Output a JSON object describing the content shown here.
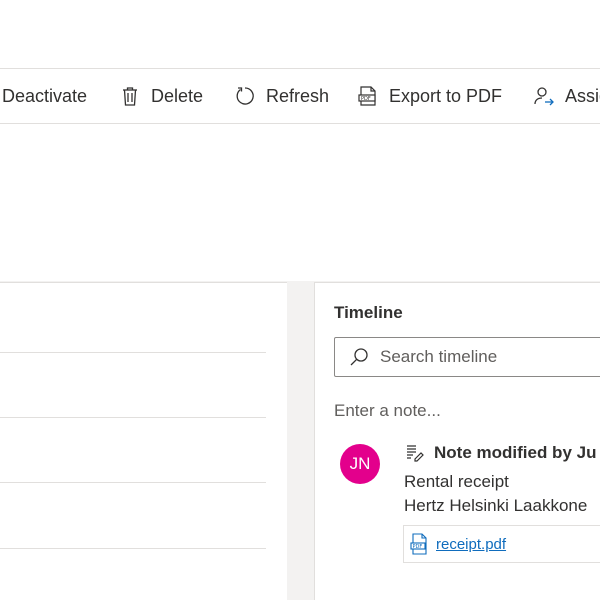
{
  "command_bar": {
    "deactivate_label": "Deactivate",
    "delete_label": "Delete",
    "refresh_label": "Refresh",
    "export_pdf_label": "Export to PDF",
    "assign_label": "Assign"
  },
  "timeline": {
    "title": "Timeline",
    "search_placeholder": "Search timeline",
    "note_placeholder": "Enter a note...",
    "entries": [
      {
        "avatar_initials": "JN",
        "avatar_color": "#e3008c",
        "title": "Note modified by Ju",
        "subject": "Rental receipt",
        "body": "Hertz Helsinki Laakkone",
        "attachment_name": "receipt.pdf"
      }
    ]
  },
  "colors": {
    "link": "#0f6cbd",
    "border": "#e1dfdd",
    "background": "#f3f2f1"
  }
}
